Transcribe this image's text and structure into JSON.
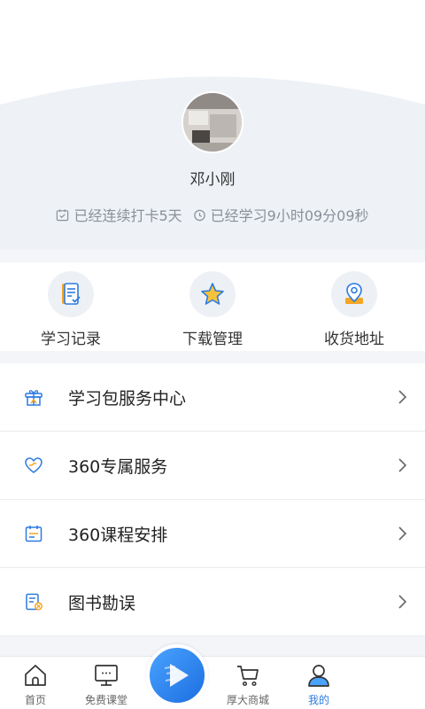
{
  "profile": {
    "username": "邓小刚",
    "checkin_text": "已经连续打卡5天",
    "study_time_text": "已经学习9小时09分09秒"
  },
  "quick_actions": [
    {
      "label": "学习记录",
      "icon": "study-record-icon"
    },
    {
      "label": "下载管理",
      "icon": "download-star-icon"
    },
    {
      "label": "收货地址",
      "icon": "location-pin-icon"
    }
  ],
  "menu": [
    {
      "label": "学习包服务中心",
      "icon": "gift-box-icon"
    },
    {
      "label": "360专属服务",
      "icon": "heart-service-icon"
    },
    {
      "label": "360课程安排",
      "icon": "calendar-icon"
    },
    {
      "label": "图书勘误",
      "icon": "book-errata-icon"
    }
  ],
  "tabs": [
    {
      "label": "首页",
      "icon": "home-icon",
      "active": false
    },
    {
      "label": "免费课堂",
      "icon": "monitor-icon",
      "active": false
    },
    {
      "label": "厚大商城",
      "icon": "cart-icon",
      "active": false
    },
    {
      "label": "我的",
      "icon": "user-icon",
      "active": true
    }
  ],
  "colors": {
    "accent": "#2d7be0",
    "header_curve": "#eef2f7",
    "icon_orange": "#f5a623"
  }
}
